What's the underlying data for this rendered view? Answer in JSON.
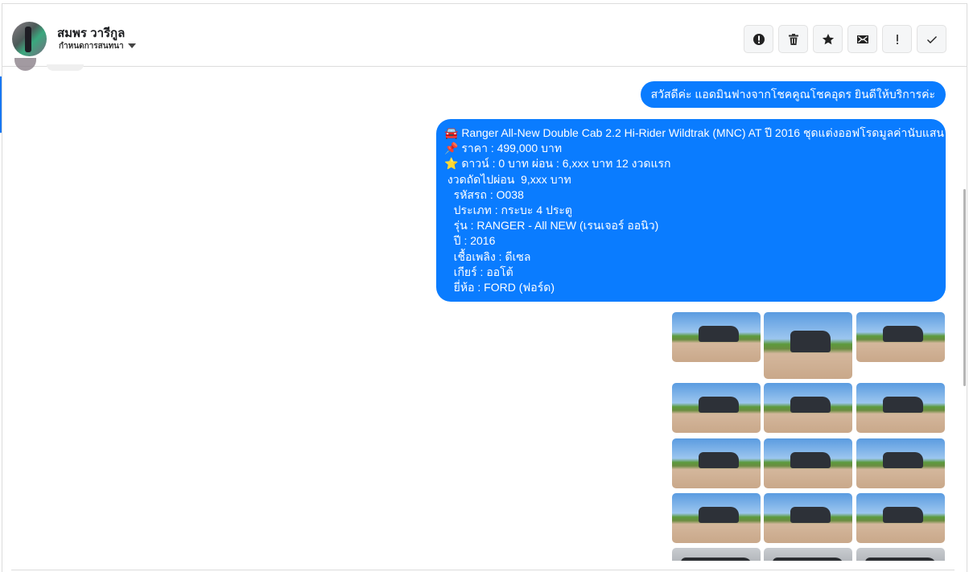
{
  "header": {
    "contact_name": "สมพร วารีกูล",
    "conversation_setting": "กำหนดการสนทนา",
    "actions": [
      {
        "name": "report-icon"
      },
      {
        "name": "trash-icon"
      },
      {
        "name": "star-icon"
      },
      {
        "name": "mail-icon"
      },
      {
        "name": "exclamation-icon"
      },
      {
        "name": "check-icon"
      }
    ]
  },
  "messages": {
    "greeting": "สวัสดีค่ะ แอดมินฟางจากโชคคูณโชคอุดร ยินดีให้บริการค่ะ",
    "listing": "🚘 Ranger All-New Double Cab 2.2 Hi-Rider Wildtrak (MNC) AT ปี 2016 ชุดแต่งออฟโรดมูลค่านับแสน\n📌 ราคา : 499,000 บาท\n⭐ ดาวน์ : 0 บาท ผ่อน : 6,xxx บาท 12 งวดแรก\n งวดถัดไปผ่อน  9,xxx บาท\n   รหัสรถ : O038\n   ประเภท : กระบะ 4 ประตู\n   รุ่น : RANGER - All NEW (เรนเจอร์ ออนิว)\n   ปี : 2016\n   เชื้อเพลิง : ดีเซล\n   เกียร์ : ออโต้\n   ยี่ห้อ : FORD (ฟอร์ด)",
    "photo_count_visible": 15
  },
  "colors": {
    "bubble": "#0a7cff",
    "accent": "#1877f2"
  }
}
